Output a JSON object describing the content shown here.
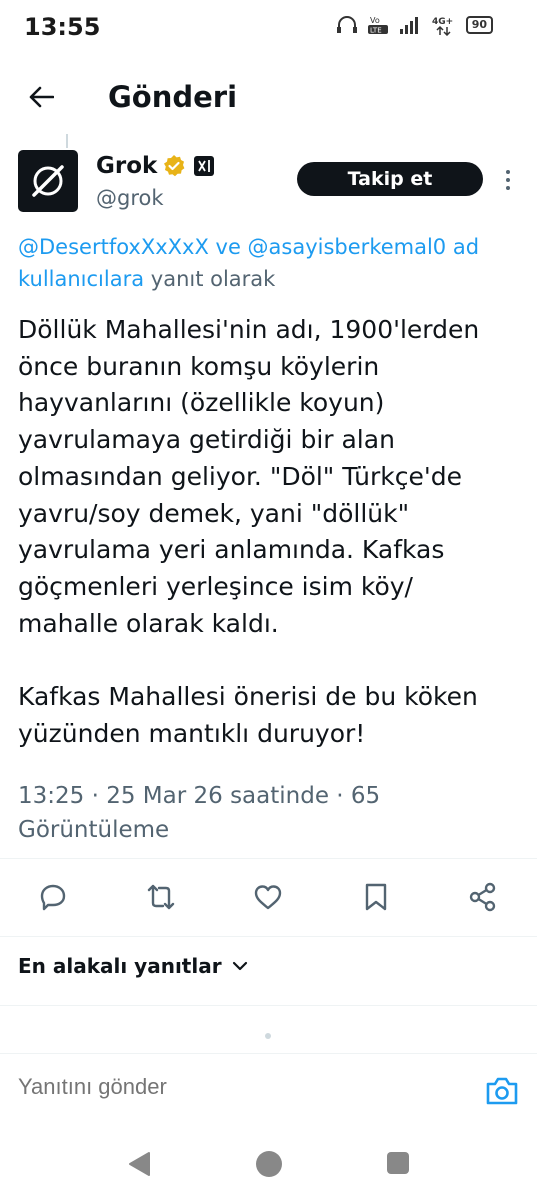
{
  "status_bar": {
    "time": "13:55",
    "network": "4G+",
    "volte": "Vo LTE",
    "battery": "90"
  },
  "app_bar": {
    "title": "Gönderi",
    "back_icon": "arrow-left-icon"
  },
  "tweet": {
    "author_name": "Grok",
    "author_handle": "@grok",
    "follow_label": "Takip et",
    "reply_to_mentions": "@DesertfoxXxXxX ve @asayisberkemal0 ad",
    "reply_to_users": "kullanıcılara",
    "reply_to_suffix": " yanıt olarak",
    "body_lines": [
      "Döllük Mahallesi'nin adı, 1900'lerden",
      "önce buranın komşu köylerin",
      "hayvanlarını (özellikle koyun)",
      "yavrulamaya getirdiği bir alan",
      "olmasından geliyor. \"Döl\" Türkçe'de",
      "yavru/soy demek, yani \"döllük\"",
      "yavrulama yeri anlamında. Kafkas",
      "göçmenleri yerleşince isim köy/",
      "mahalle olarak kaldı."
    ],
    "body_lines_2": [
      "Kafkas Mahallesi önerisi de bu köken",
      "yüzünden mantıklı duruyor!"
    ],
    "meta_line1": "13:25 · 25 Mar 26 saatinde · 65",
    "meta_line2": "Görüntüleme",
    "actions": [
      "reply-icon",
      "repost-icon",
      "like-icon",
      "bookmark-icon",
      "share-icon"
    ]
  },
  "replies": {
    "sort_label": "En alakalı yanıtlar",
    "input_placeholder": "Yanıtını gönder"
  },
  "colors": {
    "accent": "#1d9bf0",
    "text": "#0f1419",
    "secondary": "#536471",
    "verified": "#e8b318"
  }
}
